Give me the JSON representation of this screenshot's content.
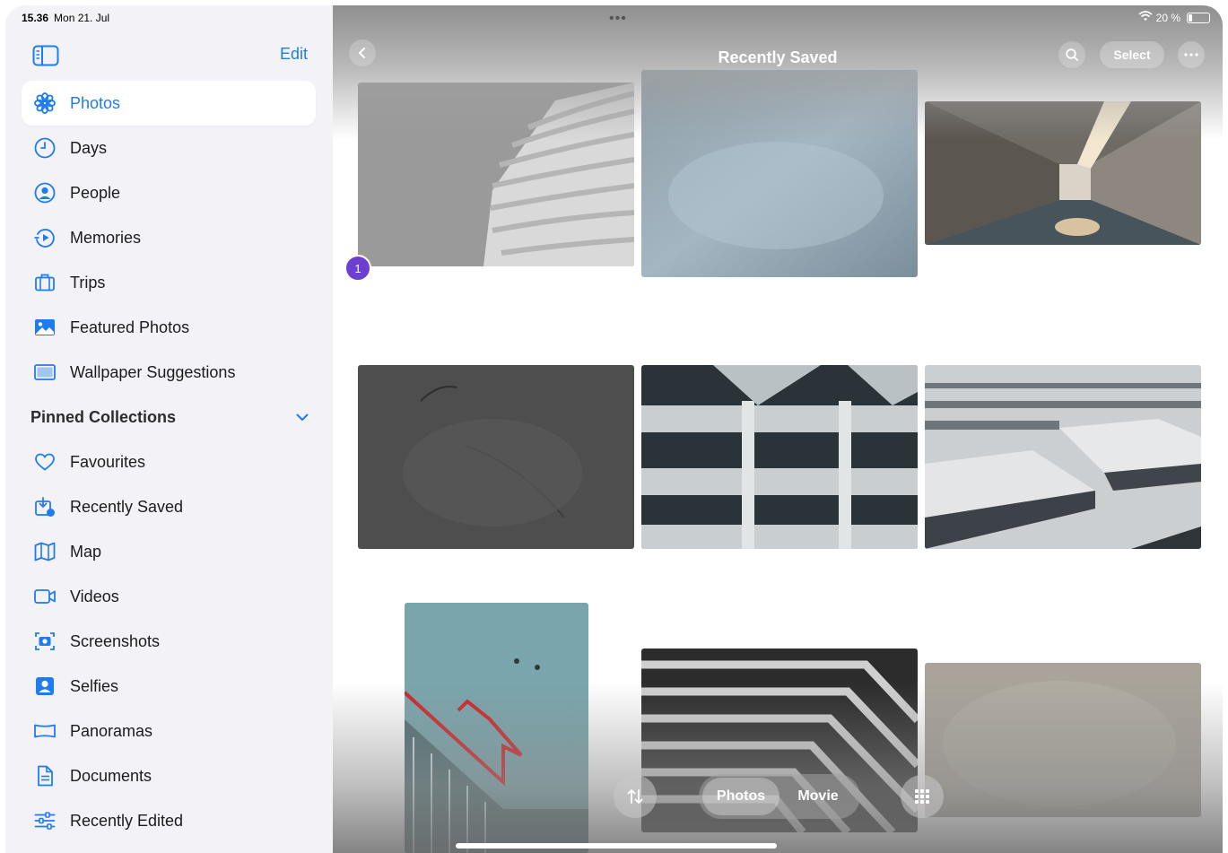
{
  "status": {
    "time": "15.36",
    "date": "Mon 21. Jul",
    "battery": "20 %",
    "battery_level": 0.2
  },
  "sidebar": {
    "edit_label": "Edit",
    "items": [
      {
        "label": "Photos",
        "icon": "photos-flower-icon",
        "active": true
      },
      {
        "label": "Days",
        "icon": "clock-icon"
      },
      {
        "label": "People",
        "icon": "person-circle-icon"
      },
      {
        "label": "Memories",
        "icon": "memories-play-icon"
      },
      {
        "label": "Trips",
        "icon": "suitcase-icon"
      },
      {
        "label": "Featured Photos",
        "icon": "featured-photo-icon"
      },
      {
        "label": "Wallpaper Suggestions",
        "icon": "wallpaper-icon"
      }
    ],
    "pinned_header": "Pinned Collections",
    "pinned": [
      {
        "label": "Favourites",
        "icon": "heart-icon"
      },
      {
        "label": "Recently Saved",
        "icon": "recently-saved-icon"
      },
      {
        "label": "Map",
        "icon": "map-icon"
      },
      {
        "label": "Videos",
        "icon": "video-icon"
      },
      {
        "label": "Screenshots",
        "icon": "screenshot-icon"
      },
      {
        "label": "Selfies",
        "icon": "selfie-icon"
      },
      {
        "label": "Panoramas",
        "icon": "panorama-icon"
      },
      {
        "label": "Documents",
        "icon": "document-icon"
      },
      {
        "label": "Recently Edited",
        "icon": "sliders-icon"
      }
    ]
  },
  "main": {
    "title": "Recently Saved",
    "select_label": "Select",
    "badge": "1",
    "segment": {
      "photos": "Photos",
      "movie": "Movie"
    }
  },
  "colors": {
    "accent": "#1f7cf0",
    "badge": "#6d3fd1"
  }
}
